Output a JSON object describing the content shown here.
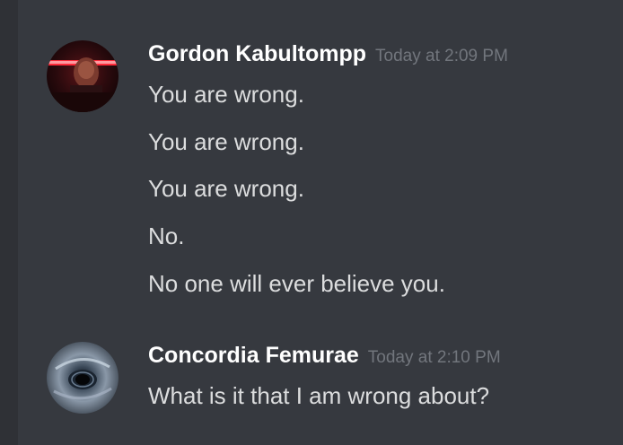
{
  "colors": {
    "background": "#36393f",
    "rail": "#2f3136",
    "username": "#ffffff",
    "timestamp": "#72767d",
    "message_text": "#dcddde"
  },
  "messages": [
    {
      "author": "Gordon Kabultompp",
      "timestamp": "Today at 2:09 PM",
      "avatar_icon": "neon-photo-avatar-icon",
      "lines": [
        "You are wrong.",
        "You are wrong.",
        "You are wrong.",
        "No.",
        "No one will ever believe you."
      ]
    },
    {
      "author": "Concordia Femurae",
      "timestamp": "Today at 2:10 PM",
      "avatar_icon": "blackhole-avatar-icon",
      "lines": [
        "What is it that I am wrong about?"
      ]
    }
  ]
}
